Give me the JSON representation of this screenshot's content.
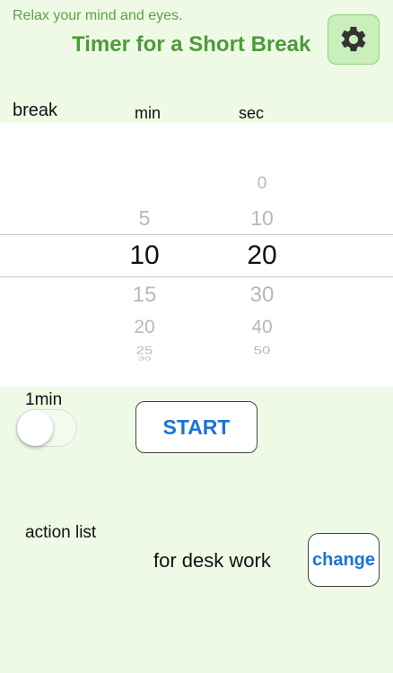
{
  "header": {
    "subtitle": "Relax your mind and eyes.",
    "title": "Timer for a Short Break",
    "settings_icon": "gear-icon"
  },
  "picker": {
    "labels": {
      "break": "break",
      "min": "min",
      "sec": "sec"
    },
    "minutes": {
      "above": [
        "5"
      ],
      "selected": "10",
      "below": [
        "15",
        "20",
        "25",
        "30"
      ]
    },
    "seconds": {
      "above": [
        "0",
        "10"
      ],
      "selected": "20",
      "below": [
        "30",
        "40",
        "50"
      ]
    }
  },
  "toggle": {
    "label": "1min",
    "on": false
  },
  "start_button": {
    "label": "START"
  },
  "action": {
    "label": "action list",
    "value": "for desk work",
    "change_label": "change"
  },
  "colors": {
    "background": "#eef9e6",
    "title_green": "#4f9a3b",
    "button_blue": "#1a73d9"
  }
}
